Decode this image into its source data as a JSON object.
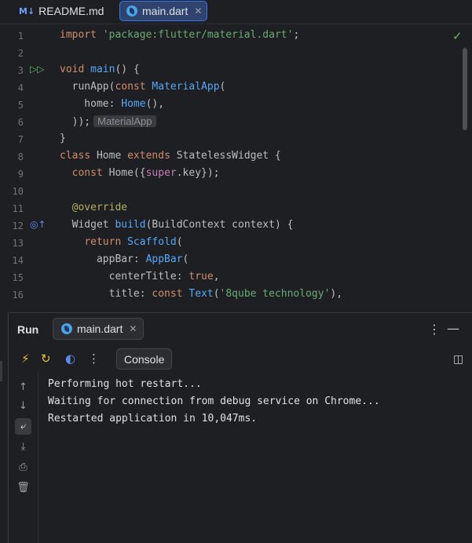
{
  "tabs": [
    {
      "label": "README.md",
      "icon": "markdown-icon",
      "badge": "M↓"
    },
    {
      "label": "main.dart",
      "icon": "dart-file-icon",
      "active": true
    }
  ],
  "editor": {
    "lines": [
      {
        "num": "1"
      },
      {
        "num": "2"
      },
      {
        "num": "3"
      },
      {
        "num": "4"
      },
      {
        "num": "5"
      },
      {
        "num": "6"
      },
      {
        "num": "7"
      },
      {
        "num": "8"
      },
      {
        "num": "9"
      },
      {
        "num": "10"
      },
      {
        "num": "11"
      },
      {
        "num": "12"
      },
      {
        "num": "13"
      },
      {
        "num": "14"
      },
      {
        "num": "15"
      },
      {
        "num": "16"
      }
    ],
    "code": {
      "l1_kw": "import",
      "l1_str": "'package:flutter/material.dart'",
      "l1_end": ";",
      "l3_kw": "void",
      "l3_fn": "main",
      "l3_end": "() {",
      "l4_a": "  runApp(",
      "l4_kw": "const",
      "l4_cls": "MaterialApp",
      "l4_end": "(",
      "l5_a": "    home: ",
      "l5_cls": "Home",
      "l5_end": "(),",
      "l6_a": "  ));",
      "l6_hint": "MaterialApp",
      "l7": "}",
      "l8_kw": "class",
      "l8_a": "Home",
      "l8_kw2": "extends",
      "l8_b": "StatelessWidget {",
      "l9_kw": "const",
      "l9_a": "Home({",
      "l9_sup": "super",
      "l9_b": ".key});",
      "l11_ann": "@override",
      "l12_a": "  Widget ",
      "l12_fn": "build",
      "l12_b": "(BuildContext context) {",
      "l13_kw": "return",
      "l13_cls": "Scaffold",
      "l13_end": "(",
      "l14_a": "      appBar: ",
      "l14_cls": "AppBar",
      "l14_end": "(",
      "l15_a": "        centerTitle: ",
      "l15_kw": "true",
      "l15_end": ",",
      "l16_a": "        title: ",
      "l16_kw": "const",
      "l16_cls": "Text",
      "l16_str": "'8qube technology'",
      "l16_end": "),"
    }
  },
  "run": {
    "title": "Run",
    "tab_label": "main.dart",
    "console_label": "Console",
    "output": [
      "Performing hot restart...",
      "Waiting for connection from debug service on Chrome...",
      "Restarted application in 10,047ms."
    ]
  },
  "colors": {
    "accent": "#3574f0",
    "keyword": "#cf8e6d",
    "string": "#6aab73",
    "function": "#56a8f5"
  }
}
